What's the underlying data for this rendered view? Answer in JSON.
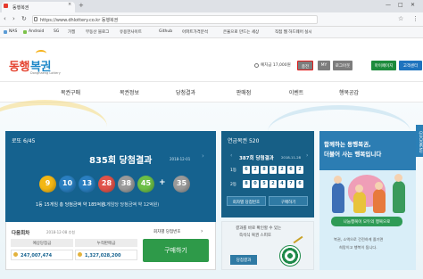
{
  "browser": {
    "tab_title": "동행복권",
    "tab_close": "×",
    "new_tab": "+",
    "url": "https://www.dhlottery.co.kr 동행복권",
    "window_controls": [
      "—",
      "□",
      "✕"
    ],
    "nav": [
      "‹",
      "›",
      "↻"
    ],
    "tools": [
      "☆",
      "⋮"
    ],
    "bookmarks": [
      "NAS",
      "Android",
      "SG",
      "가필",
      "부동산 블로그",
      "유용한사이트",
      "Github",
      "아파트가격분석",
      "은율으로 만드는 세상",
      "직접 웹 하드웨어 실시"
    ]
  },
  "site": {
    "logo_part1": "동행",
    "logo_part2": "복권",
    "logo_sub": "Donghaeng Lottery",
    "deposit": "예치금 17,000원",
    "header_buttons": [
      "충전",
      "MY",
      "로그아웃",
      "마이페이지",
      "고객센터"
    ],
    "gnb": [
      "복권구매",
      "복권정보",
      "당첨결과",
      "판매점",
      "이벤트",
      "행복공감"
    ]
  },
  "lotto": {
    "title": "로또 6/45",
    "round": "835회 당첨결과",
    "date": "2018-12-01",
    "nav_prev": "‹",
    "nav_next": "›",
    "balls": [
      {
        "number": "9",
        "color": "#f3b715"
      },
      {
        "number": "10",
        "color": "#2a7fc1"
      },
      {
        "number": "13",
        "color": "#2a7fc1"
      },
      {
        "number": "28",
        "color": "#e0534a"
      },
      {
        "number": "38",
        "color": "#9a9a9a"
      },
      {
        "number": "45",
        "color": "#6dbf47"
      }
    ],
    "plus": "+",
    "bonus": {
      "number": "35",
      "color": "#9a9a9a"
    },
    "result_line1": "1등 15게임 총 당첨금액 약 185억원",
    "result_line2": "(1게임당 당첨금액 약 12억원)",
    "next_title": "다음회차",
    "next_date": "2018-12-08 추첨",
    "prev_result": "회차별 당첨번호",
    "prev_arrow": "›",
    "stats_headers": [
      "예상당첨금",
      "누적판매금"
    ],
    "stats_values": [
      "247,007,474",
      "1,327,028,200"
    ],
    "buy_label": "구매하기"
  },
  "pension": {
    "title": "연금복권 520",
    "round": "387회 당첨결과",
    "date": "2018-11-28",
    "nav_prev": "‹",
    "nav_next": "›",
    "rows": [
      {
        "label": "1등",
        "digits": [
          "6",
          "2",
          "8",
          "9",
          "2",
          "6",
          "2"
        ]
      },
      {
        "label": "2등",
        "digits": [
          "8",
          "0",
          "5",
          "2",
          "4",
          "7",
          "6"
        ]
      }
    ],
    "buttons": [
      "회차별 당첨번호",
      "구매하기"
    ],
    "instant_l1": "결과를 바로 확인할 수 있는",
    "instant_l2": "즉석식 복권 스피또",
    "instant_btn": "당첨결과"
  },
  "ad": {
    "line1": "함께하는 동행복권,",
    "line2": "더불어 사는 행복입니다",
    "ribbon": "나눔행복이 모두의 행복으로",
    "body1": "복권, 소액으로 건전하게 즐기면",
    "body2": "희망이고 행복이 됩니다.",
    "quickmenu": "QUICKMENU"
  }
}
